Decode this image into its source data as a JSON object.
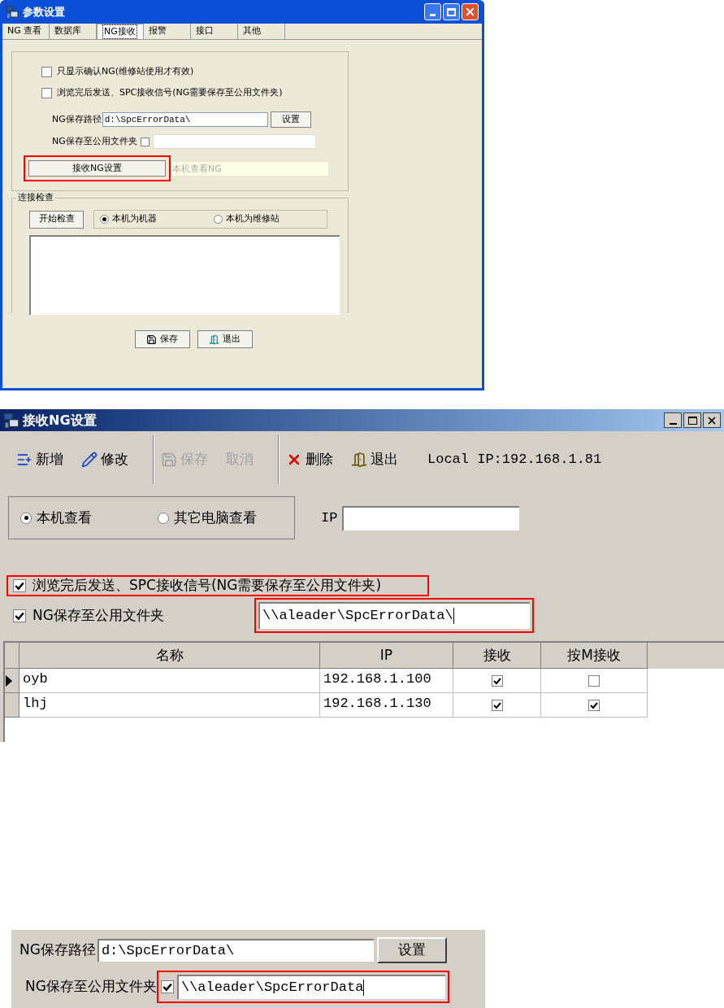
{
  "settings_window": {
    "title": "参数设置",
    "tabs": [
      {
        "label": "NG 查看",
        "selected": false
      },
      {
        "label": "数据库",
        "selected": false
      },
      {
        "label": "NG接收",
        "selected": true
      },
      {
        "label": "报警",
        "selected": false
      },
      {
        "label": "接口",
        "selected": false
      },
      {
        "label": "其他",
        "selected": false
      }
    ],
    "options": [
      {
        "label": "只显示确认NG(维修站使用才有效)",
        "checked": false
      },
      {
        "label": "浏览完后发送、SPC接收信号(NG需要保存至公用文件夹)",
        "checked": false
      }
    ],
    "path_label": "NG保存路径",
    "path_value": "d:\\SpcErrorData\\",
    "set_button": "设置",
    "share_label": "NG保存至公用文件夹",
    "share_checked": false,
    "receive_button": {
      "label": "接收NG设置",
      "highlighted": true
    },
    "receive_status": "本机查看NG",
    "check_group": {
      "title": "连接检查",
      "start_button": "开始检查",
      "radios": [
        {
          "label": "本机为机器",
          "selected": true
        },
        {
          "label": "本机为维修站",
          "selected": false
        }
      ]
    },
    "buttons": [
      {
        "label": "保存",
        "kind": "save"
      },
      {
        "label": "退出",
        "kind": "exit"
      }
    ]
  },
  "receive_window": {
    "title": "接收NG设置",
    "toolbar": [
      {
        "label": "新增",
        "kind": "add",
        "disabled": false
      },
      {
        "label": "修改",
        "kind": "edit",
        "disabled": false
      },
      {
        "label": "保存",
        "kind": "save",
        "disabled": true
      },
      {
        "label": "取消",
        "kind": "cancel",
        "disabled": true
      },
      {
        "label": "删除",
        "kind": "delete",
        "disabled": false
      },
      {
        "label": "退出",
        "kind": "exit",
        "disabled": false
      }
    ],
    "local_ip": "Local IP:192.168.1.81",
    "radios": [
      {
        "label": "本机查看",
        "selected": true
      },
      {
        "label": "其它电脑查看",
        "selected": false
      }
    ],
    "ip_label": "IP",
    "send_option": {
      "label": "浏览完后发送、SPC接收信号(NG需要保存至公用文件夹)",
      "checked": true,
      "highlighted": true
    },
    "share_option": {
      "label": "NG保存至公用文件夹",
      "checked": true
    },
    "share_path": {
      "value": "\\\\aleader\\SpcErrorData\\",
      "highlighted": true
    },
    "table": {
      "columns": [
        "名称",
        "IP",
        "接收",
        "按M接收"
      ],
      "rows": [
        {
          "name": "oyb",
          "ip": "192.168.1.100",
          "receive": true,
          "receive_m": false,
          "current": true
        },
        {
          "name": "lhj",
          "ip": "192.168.1.130",
          "receive": true,
          "receive_m": true,
          "current": false
        }
      ]
    }
  },
  "detail_crop": {
    "path_label": "NG保存路径",
    "path_value": "d:\\SpcErrorData\\",
    "set_button": "设置",
    "share_label": "NG保存至公用文件夹",
    "share_checked": true,
    "share_value": "\\\\aleader\\SpcErrorData",
    "highlighted": true
  }
}
